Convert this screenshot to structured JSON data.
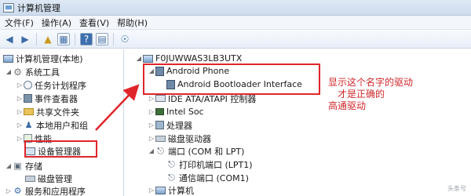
{
  "window": {
    "title": "计算机管理"
  },
  "menu": [
    "文件(F)",
    "操作(A)",
    "查看(V)",
    "帮助(H)"
  ],
  "toolbar": {
    "buttons": [
      "back-arrow",
      "forward-arrow",
      "up-folder",
      "show-hide-tree",
      "help",
      "properties",
      "scan-hardware"
    ]
  },
  "left_tree": {
    "root": "计算机管理(本地)",
    "system_tools": "系统工具",
    "task_scheduler": "任务计划程序",
    "event_viewer": "事件查看器",
    "shared_folders": "共享文件夹",
    "local_users": "本地用户和组",
    "performance": "性能",
    "device_manager": "设备管理器",
    "storage": "存储",
    "disk_management": "磁盘管理",
    "services": "服务和应用程序"
  },
  "right_tree": {
    "computer": "F0JUWWAS3LB3UTX",
    "android_phone": "Android Phone",
    "bootloader": "Android Bootloader Interface",
    "ide": "IDE ATA/ATAPI 控制器",
    "intel_soc": "Intel Soc",
    "processor": "处理器",
    "disk_drives": "磁盘驱动器",
    "ports": "端口 (COM 和 LPT)",
    "printer_port": "打印机端口 (LPT1)",
    "comm_port": "通信端口 (COM1)",
    "computer_node": "计算机"
  },
  "annotation": {
    "line1": "显示这个名字的驱动",
    "line2": "才是正确的",
    "line3": "高通驱动"
  },
  "watermark": "头条号",
  "colors": {
    "annotation": "#e0252a"
  }
}
